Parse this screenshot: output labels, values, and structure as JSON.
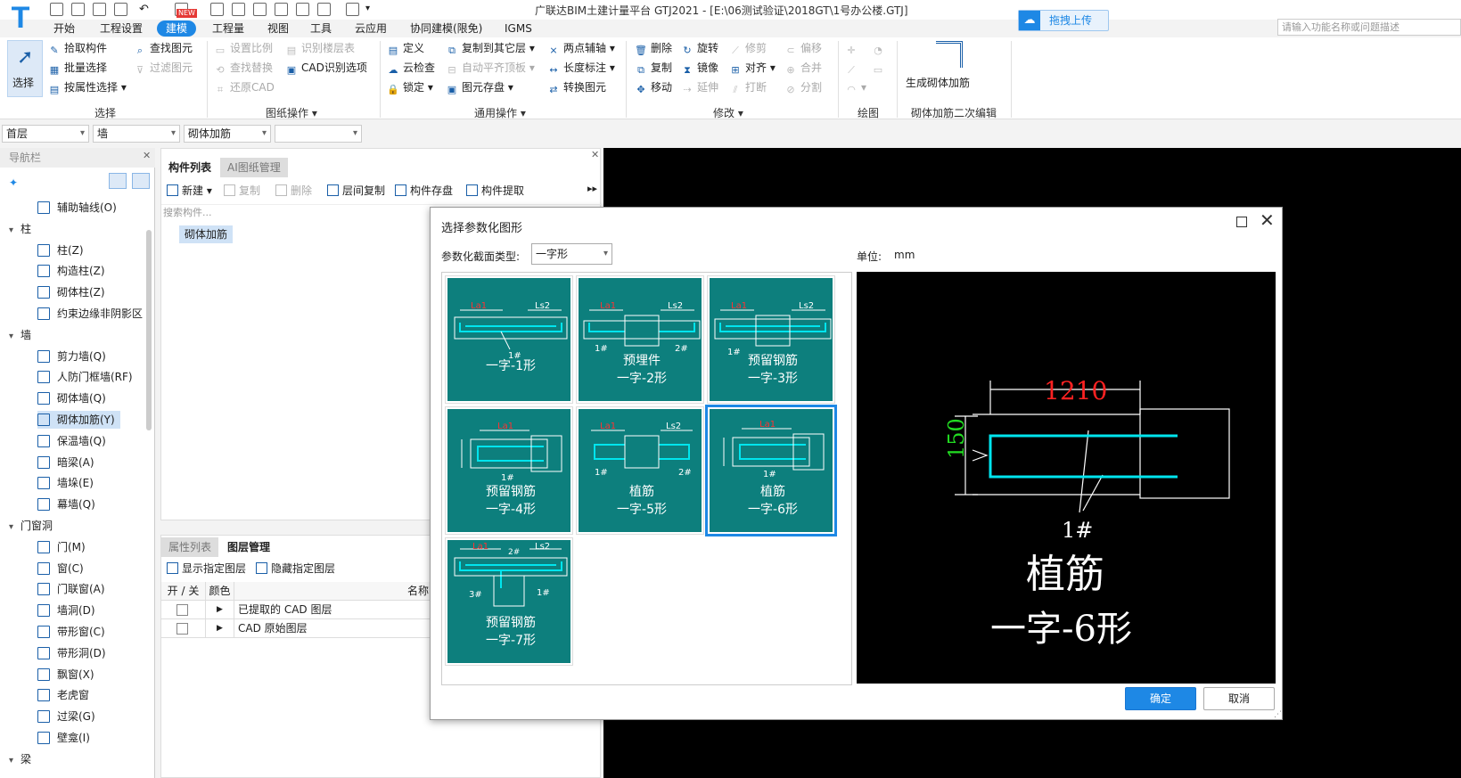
{
  "titlebar": {
    "title": "广联达BIM土建计量平台 GTJ2021 - [E:\\06测试验证\\2018GT\\1号办公楼.GTJ]",
    "logo": "T",
    "new_badge": "NEW"
  },
  "menu": [
    "开始",
    "工程设置",
    "建模",
    "工程量",
    "视图",
    "工具",
    "云应用",
    "协同建模(限免)",
    "IGMS"
  ],
  "menu_active": "建模",
  "upload_button": "拖拽上传",
  "search_placeholder": "请输入功能名称或问题描述",
  "ribbon": {
    "select_big": "选择",
    "select_items": [
      "拾取构件",
      "批量选择",
      "按属性选择",
      "查找图元",
      "过滤图元"
    ],
    "select_group": "选择",
    "drawing_items": [
      "设置比例",
      "识别楼层表",
      "查找替换",
      "CAD识别选项",
      "还原CAD"
    ],
    "drawing_group": "图纸操作",
    "common_items": [
      "定义",
      "复制到其它层",
      "两点辅轴",
      "云检查",
      "自动平齐顶板",
      "长度标注",
      "锁定",
      "图元存盘",
      "转换图元"
    ],
    "common_group": "通用操作",
    "modify_items": [
      "删除",
      "旋转",
      "修剪",
      "偏移",
      "复制",
      "镜像",
      "对齐",
      "合并",
      "移动",
      "延伸",
      "打断",
      "分割"
    ],
    "modify_group": "修改",
    "draw_group": "绘图",
    "gen_button": "生成砌体加筋",
    "gen_group": "砌体加筋二次编辑"
  },
  "dropdowns": [
    "首层",
    "墙",
    "砌体加筋",
    ""
  ],
  "nav": {
    "title": "导航栏",
    "items": [
      {
        "type": "item",
        "label": "辅助轴线(O)"
      },
      {
        "type": "cat",
        "label": "柱"
      },
      {
        "type": "item",
        "label": "柱(Z)"
      },
      {
        "type": "item",
        "label": "构造柱(Z)"
      },
      {
        "type": "item",
        "label": "砌体柱(Z)"
      },
      {
        "type": "item",
        "label": "约束边缘非阴影区"
      },
      {
        "type": "cat",
        "label": "墙"
      },
      {
        "type": "item",
        "label": "剪力墙(Q)"
      },
      {
        "type": "item",
        "label": "人防门框墙(RF)"
      },
      {
        "type": "item",
        "label": "砌体墙(Q)"
      },
      {
        "type": "item",
        "label": "砌体加筋(Y)",
        "selected": true
      },
      {
        "type": "item",
        "label": "保温墙(Q)"
      },
      {
        "type": "item",
        "label": "暗梁(A)"
      },
      {
        "type": "item",
        "label": "墙垛(E)"
      },
      {
        "type": "item",
        "label": "幕墙(Q)"
      },
      {
        "type": "cat",
        "label": "门窗洞"
      },
      {
        "type": "item",
        "label": "门(M)"
      },
      {
        "type": "item",
        "label": "窗(C)"
      },
      {
        "type": "item",
        "label": "门联窗(A)"
      },
      {
        "type": "item",
        "label": "墙洞(D)"
      },
      {
        "type": "item",
        "label": "带形窗(C)"
      },
      {
        "type": "item",
        "label": "带形洞(D)"
      },
      {
        "type": "item",
        "label": "飘窗(X)"
      },
      {
        "type": "item",
        "label": "老虎窗"
      },
      {
        "type": "item",
        "label": "过梁(G)"
      },
      {
        "type": "item",
        "label": "壁龛(I)"
      },
      {
        "type": "cat",
        "label": "梁"
      }
    ]
  },
  "component_panel": {
    "tabs": [
      "构件列表",
      "AI图纸管理"
    ],
    "toolbar": [
      "新建",
      "复制",
      "删除",
      "层间复制",
      "构件存盘",
      "构件提取"
    ],
    "search_placeholder": "搜索构件...",
    "items": [
      "砌体加筋"
    ]
  },
  "layer_panel": {
    "tabs": [
      "属性列表",
      "图层管理"
    ],
    "buttons": [
      "显示指定图层",
      "隐藏指定图层"
    ],
    "columns": [
      "开 / 关",
      "颜色",
      "名称"
    ],
    "rows": [
      "已提取的 CAD 图层",
      "CAD 原始图层"
    ]
  },
  "dialog": {
    "title": "选择参数化图形",
    "type_label": "参数化截面类型:",
    "type_value": "一字形",
    "unit_label": "单位:",
    "unit_value": "mm",
    "shapes": [
      {
        "label": [
          "一字-1形"
        ]
      },
      {
        "label": [
          "预埋件",
          "一字-2形"
        ]
      },
      {
        "label": [
          "预留钢筋",
          "一字-3形"
        ]
      },
      {
        "label": [
          "预留钢筋",
          "一字-4形"
        ]
      },
      {
        "label": [
          "植筋",
          "一字-5形"
        ]
      },
      {
        "label": [
          "植筋",
          "一字-6形"
        ],
        "selected": true
      },
      {
        "label": [
          "预留钢筋",
          "一字-7形"
        ]
      }
    ],
    "preview": {
      "dim_length": "1210",
      "dim_height": "150",
      "bar_mark": "1#",
      "title1": "植筋",
      "title2": "一字-6形"
    },
    "ok": "确定",
    "cancel": "取消"
  },
  "colors": {
    "accent": "#1e88e5",
    "teal": "#0d7f7d",
    "rebar": "#00e5ee",
    "dim_red": "#ff2222",
    "dim_green": "#22dd22"
  }
}
